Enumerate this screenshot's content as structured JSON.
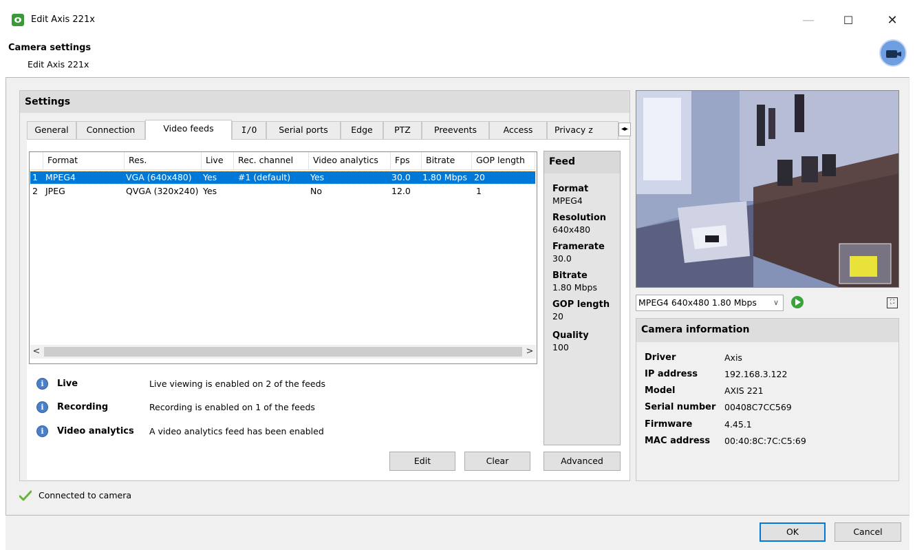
{
  "window": {
    "title": "Edit Axis 221x",
    "controls": {
      "minimize": "—",
      "maximize": "☐",
      "close": "✕"
    }
  },
  "header": {
    "title": "Camera settings",
    "subtitle": "Edit Axis 221x"
  },
  "settings": {
    "title": "Settings",
    "tabs": [
      "General",
      "Connection",
      "Video feeds",
      "I/O",
      "Serial ports",
      "Edge",
      "PTZ",
      "Preevents",
      "Access",
      "Privacy z"
    ],
    "active_tab": "Video feeds",
    "tab_scroll_label": "◂▸"
  },
  "feeds_table": {
    "columns": [
      "Format",
      "Res.",
      "Live",
      "Rec. channel",
      "Video analytics",
      "Fps",
      "Bitrate",
      "GOP length"
    ],
    "rows": [
      {
        "num": "1",
        "format": "MPEG4",
        "res": "VGA (640x480)",
        "live": "Yes",
        "rec": "#1 (default)",
        "va": "Yes",
        "fps": "30.0",
        "bitrate": "1.80 Mbps",
        "gop": "20"
      },
      {
        "num": "2",
        "format": "JPEG",
        "res": "QVGA (320x240)",
        "live": "Yes",
        "rec": "",
        "va": "No",
        "fps": "12.0",
        "bitrate": "",
        "gop": "1"
      }
    ],
    "scroll_left": "<",
    "scroll_right": ">"
  },
  "feed": {
    "title": "Feed",
    "fields": [
      {
        "label": "Format",
        "value": "MPEG4"
      },
      {
        "label": "Resolution",
        "value": "640x480"
      },
      {
        "label": "Framerate",
        "value": "30.0"
      },
      {
        "label": "Bitrate",
        "value": "1.80 Mbps"
      },
      {
        "label": "GOP length",
        "value": "20"
      },
      {
        "label": "Quality",
        "value": "100"
      }
    ]
  },
  "info_lines": [
    {
      "label": "Live",
      "text": "Live viewing is enabled on 2 of the feeds"
    },
    {
      "label": "Recording",
      "text": "Recording is enabled on 1 of the feeds"
    },
    {
      "label": "Video analytics",
      "text": "A video analytics feed has been enabled"
    }
  ],
  "buttons": {
    "edit": "Edit",
    "clear": "Clear",
    "advanced": "Advanced",
    "ok": "OK",
    "cancel": "Cancel"
  },
  "preview": {
    "feed_select": "MPEG4 640x480 1.80 Mbps",
    "fullscreen_glyph": "⛶"
  },
  "camera_info": {
    "title": "Camera information",
    "fields": [
      {
        "label": "Driver",
        "value": "Axis"
      },
      {
        "label": "IP address",
        "value": "192.168.3.122"
      },
      {
        "label": "Model",
        "value": "AXIS 221"
      },
      {
        "label": "Serial number",
        "value": "00408C7CC569"
      },
      {
        "label": "Firmware",
        "value": "4.45.1"
      },
      {
        "label": "MAC address",
        "value": "00:40:8C:7C:C5:69"
      }
    ]
  },
  "status": {
    "text": "Connected to camera"
  },
  "colors": {
    "selection": "#0078d7",
    "accent_green": "#3aa33a",
    "info_blue": "#4a7fc9"
  },
  "icons": [
    "app-eye-icon",
    "camera-badge-icon",
    "info-icon",
    "play-icon",
    "fullscreen-icon",
    "checkmark-icon",
    "tab-scroll-icon"
  ]
}
